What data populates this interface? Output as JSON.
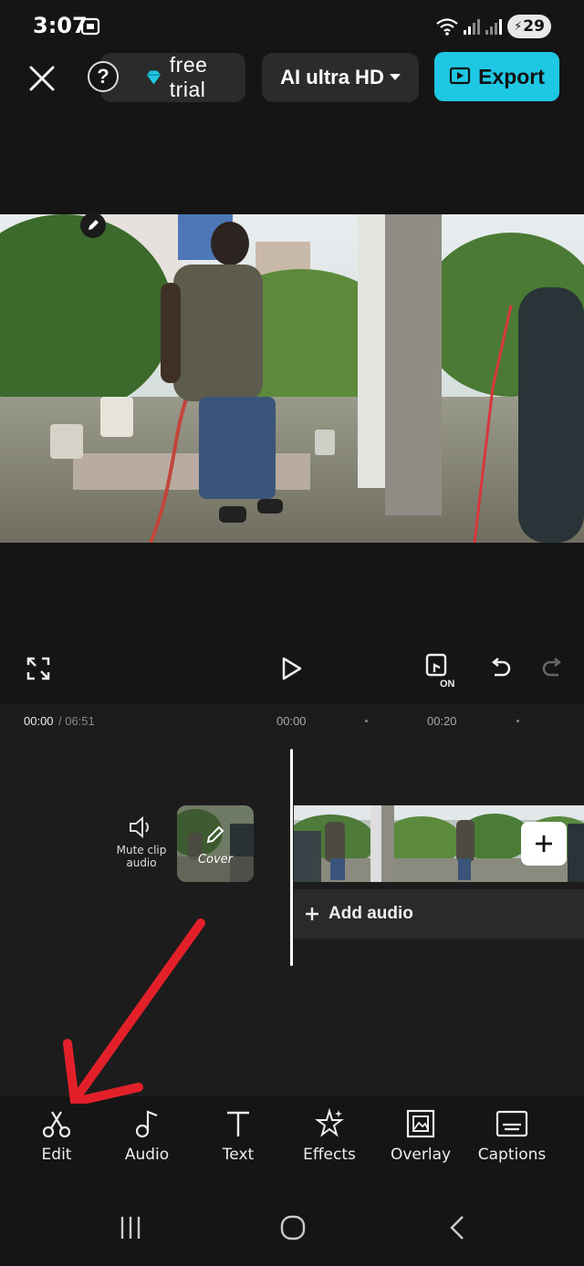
{
  "status": {
    "time": "3:07",
    "battery": "29",
    "icons": [
      "screenshot-icon",
      "wifi-icon",
      "signal-icon",
      "signal-icon",
      "battery-icon"
    ]
  },
  "header": {
    "trial_label": "free trial",
    "quality_label": "AI ultra HD",
    "export_label": "Export",
    "help_symbol": "?"
  },
  "player": {
    "current_time": "00:00",
    "total_time": "/ 06:51",
    "ticks": [
      "00:00",
      "00:20"
    ]
  },
  "timeline": {
    "mute_label": "Mute clip audio",
    "cover_label": "Cover",
    "add_audio_label": "Add audio"
  },
  "tools": [
    {
      "label": "Edit",
      "icon": "scissors-icon"
    },
    {
      "label": "Audio",
      "icon": "music-note-icon"
    },
    {
      "label": "Text",
      "icon": "text-icon"
    },
    {
      "label": "Effects",
      "icon": "star-sparkle-icon"
    },
    {
      "label": "Overlay",
      "icon": "overlay-icon"
    },
    {
      "label": "Captions",
      "icon": "captions-icon"
    }
  ],
  "colors": {
    "accent": "#1ec7e3",
    "background": "#151515",
    "arrow": "#e3202a"
  }
}
